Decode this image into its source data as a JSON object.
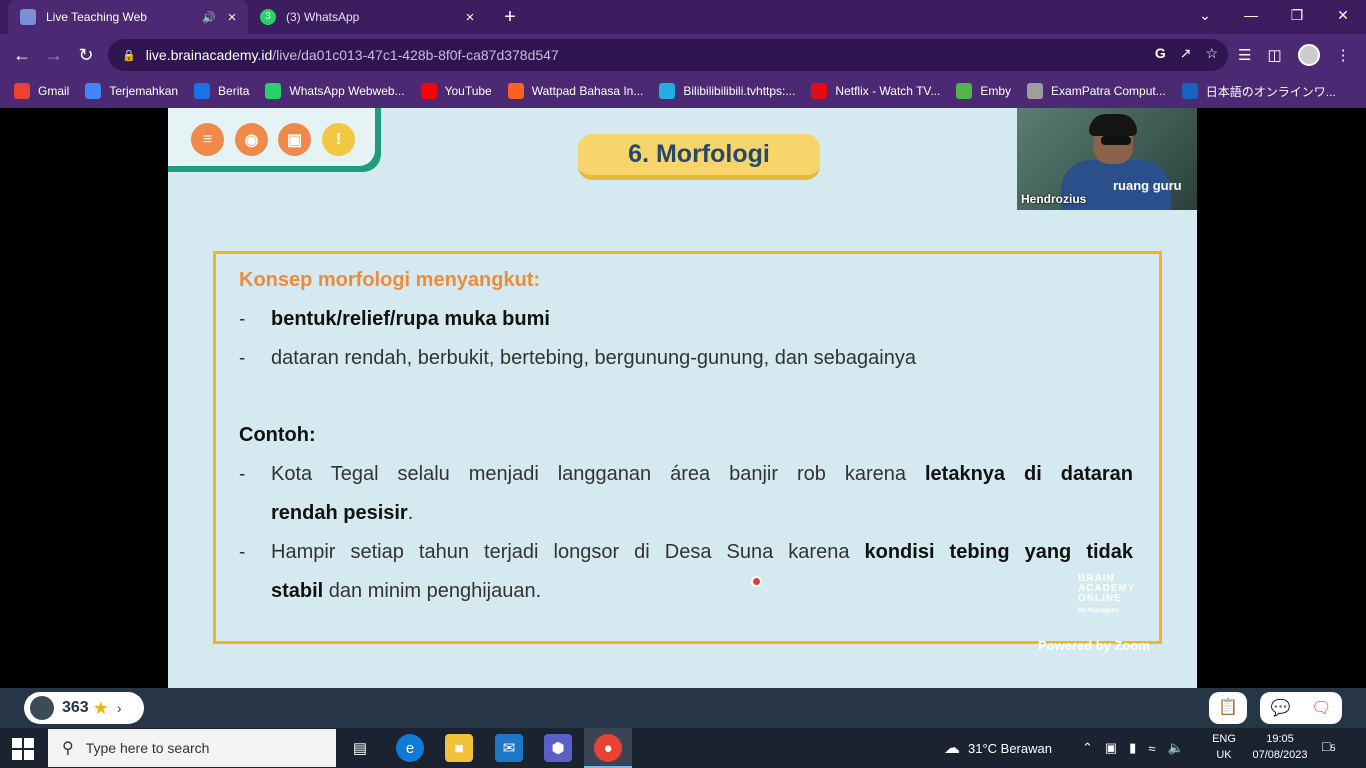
{
  "browser": {
    "tabs": [
      {
        "title": "Live Teaching Web",
        "active": true
      },
      {
        "title": "(3) WhatsApp",
        "active": false
      }
    ],
    "whatsapp_badge": "3",
    "url_host": "live.brainacademy.id",
    "url_path": "/live/da01c013-47c1-428b-8f0f-ca87d378d547",
    "bookmarks": [
      {
        "label": "Gmail",
        "color": "#ea4335"
      },
      {
        "label": "Terjemahkan",
        "color": "#4285f4"
      },
      {
        "label": "Berita",
        "color": "#1a73e8"
      },
      {
        "label": "WhatsApp Webweb...",
        "color": "#25d366"
      },
      {
        "label": "YouTube",
        "color": "#ff0000"
      },
      {
        "label": "Wattpad Bahasa In...",
        "color": "#ff6122"
      },
      {
        "label": "Bilibilibilibili.tvhttps:...",
        "color": "#23ade5"
      },
      {
        "label": "Netflix - Watch TV...",
        "color": "#e50914"
      },
      {
        "label": "Emby",
        "color": "#52b54b"
      },
      {
        "label": "ExamPatra Comput...",
        "color": "#9e9e9e"
      },
      {
        "label": "日本語のオンラインワ...",
        "color": "#1565c0"
      }
    ]
  },
  "slide": {
    "heading": "6. Morfologi",
    "presenter_name": "Hendrozius",
    "shirt_text": "ruang guru",
    "concept_title": "Konsep morfologi menyangkut:",
    "bullet1": "bentuk/relief/rupa muka bumi",
    "bullet2": "dataran rendah, berbukit, bertebing, bergunung-gunung, dan sebagainya",
    "contoh_title": "Contoh:",
    "ex1_plain": "Kota Tegal selalu menjadi langganan área banjir rob karena",
    "ex1_bold_a": "letaknya di dataran",
    "ex1_bold_b": "rendah pesisir",
    "ex1_end": ".",
    "ex2_plain": "Hampir setiap tahun terjadi longsor di Desa Suna karena",
    "ex2_bold_a": "kondisi tebing yang tidak",
    "ex2_bold_b": "stabil",
    "ex2_end": " dan minim penghijauan.",
    "logo_text": "BRAIN ACADEMY ONLINE",
    "logo_sub": "By Ruangguru",
    "powered": "Powered by Zoom",
    "dash": "-"
  },
  "bottombar": {
    "points": "363"
  },
  "taskbar": {
    "search_placeholder": "Type here to search",
    "weather": "31°C  Berawan",
    "lang1": "ENG",
    "lang2": "UK",
    "time": "19:05",
    "date": "07/08/2023",
    "notif_count": "5"
  },
  "colors": {
    "browser_bg": "#4b2a73",
    "slide_bg": "#d5eaf0",
    "accent_orange": "#ee8b3b",
    "box_border": "#f3b51b",
    "heading_bg": "#f7d56b",
    "heading_text": "#27486a"
  }
}
